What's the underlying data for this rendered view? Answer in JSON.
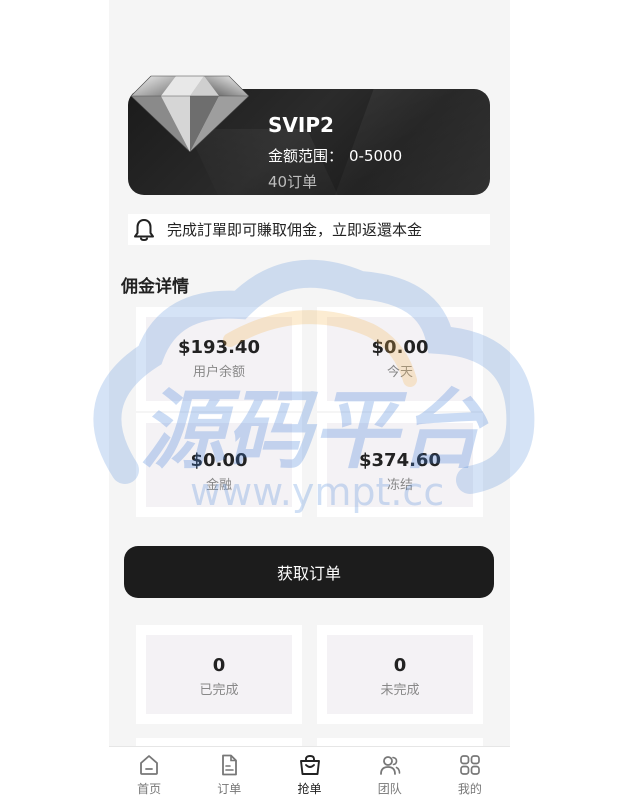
{
  "vip": {
    "level": "SVIP2",
    "range_label": "金额范围：",
    "range_value": "0-5000",
    "orders": "40订单"
  },
  "notice": {
    "icon": "bell-icon",
    "text": "完成訂單即可賺取佣金，立即返還本金"
  },
  "commission": {
    "title": "佣金详情",
    "stats": [
      {
        "value": "$193.40",
        "label": "用户余额"
      },
      {
        "value": "$0.00",
        "label": "今天"
      },
      {
        "value": "$0.00",
        "label": "金融"
      },
      {
        "value": "$374.60",
        "label": "冻结"
      }
    ]
  },
  "action": {
    "get_orders": "获取订单"
  },
  "order_counts": [
    {
      "value": "0",
      "label": "已完成"
    },
    {
      "value": "0",
      "label": "未完成"
    }
  ],
  "tabs": [
    {
      "label": "首页",
      "icon": "home-icon"
    },
    {
      "label": "订单",
      "icon": "document-icon"
    },
    {
      "label": "抢单",
      "icon": "bag-icon",
      "active": true
    },
    {
      "label": "团队",
      "icon": "team-icon"
    },
    {
      "label": "我的",
      "icon": "grid-icon"
    }
  ],
  "watermark": {
    "text": "源码平台",
    "url": "www.ympt.cc"
  },
  "colors": {
    "card": "#222222",
    "button": "#1c1c1c",
    "page": "#f5f5f5",
    "watermark": "#3f7fd6"
  }
}
